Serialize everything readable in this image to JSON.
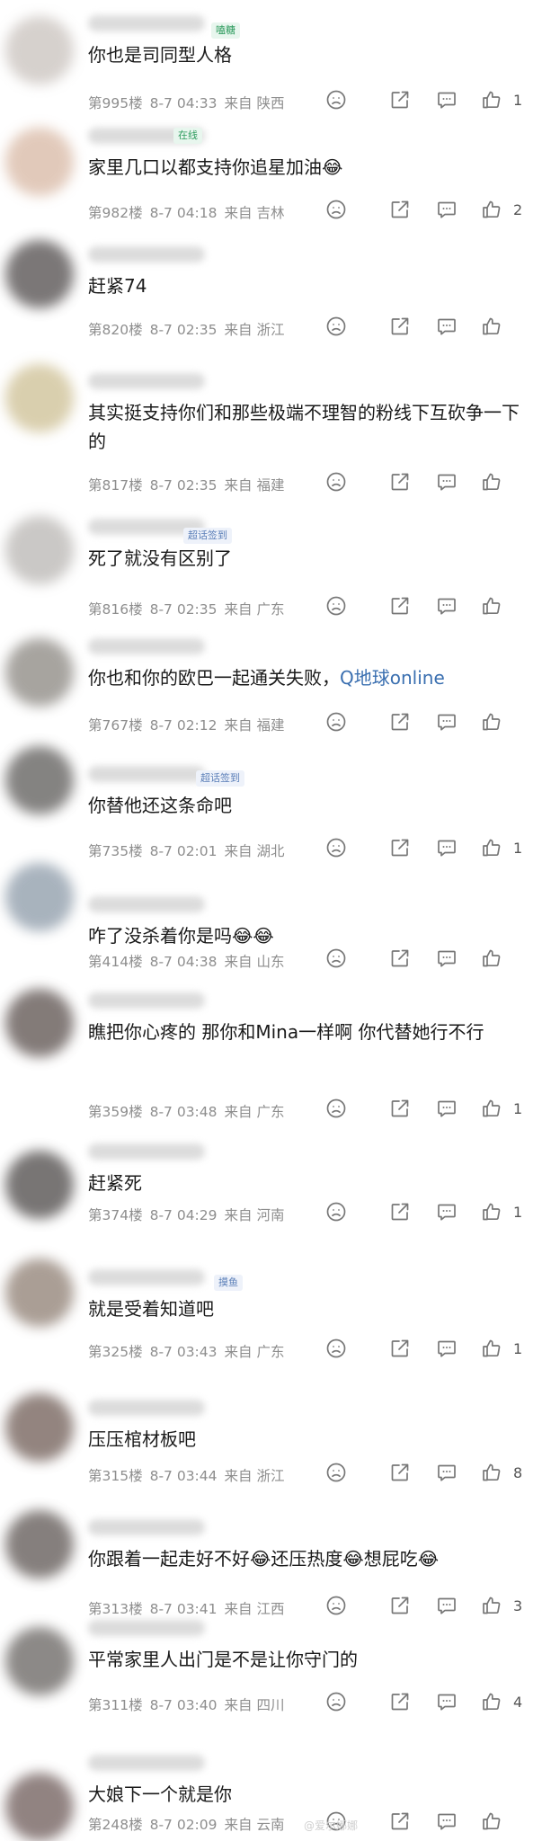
{
  "comments": [
    {
      "badge": "嗑糖",
      "badge_color": "#2e9b5e",
      "text": "你也是司同型人格",
      "floor": "第995楼",
      "time": "8-7 04:33",
      "source": "来自 陕西",
      "likes": "1"
    },
    {
      "badge": "在线",
      "badge_color": "#2e9b5e",
      "text": "家里几口以都支持你追星加油😂",
      "floor": "第982楼",
      "time": "8-7 04:18",
      "source": "来自 吉林",
      "likes": "2"
    },
    {
      "badge": "",
      "text": "赶紧74",
      "floor": "第820楼",
      "time": "8-7 02:35",
      "source": "来自 浙江",
      "likes": ""
    },
    {
      "badge": "",
      "text": "其实挺支持你们和那些极端不理智的粉线下互砍争一下的",
      "floor": "第817楼",
      "time": "8-7 02:35",
      "source": "来自 福建",
      "likes": ""
    },
    {
      "badge": "超话签到",
      "badge_color": "#5b7fb8",
      "text": "死了就没有区别了",
      "floor": "第816楼",
      "time": "8-7 02:35",
      "source": "来自 广东",
      "likes": ""
    },
    {
      "badge": "",
      "text": "你也和你的欧巴一起通关失败，",
      "tag": "Q地球online",
      "floor": "第767楼",
      "time": "8-7 02:12",
      "source": "来自 福建",
      "likes": ""
    },
    {
      "badge": "超话签到",
      "badge_color": "#5b7fb8",
      "text": "你替他还这条命吧",
      "floor": "第735楼",
      "time": "8-7 02:01",
      "source": "来自 湖北",
      "likes": "1"
    },
    {
      "badge": "",
      "text": "咋了没杀着你是吗😂😂",
      "floor": "第414楼",
      "time": "8-7 04:38",
      "source": "来自 山东",
      "likes": ""
    },
    {
      "badge": "",
      "text": "瞧把你心疼的 那你和Mina一样啊 你代替她行不行",
      "floor": "第359楼",
      "time": "8-7 03:48",
      "source": "来自 广东",
      "likes": "1"
    },
    {
      "badge": "",
      "text": "赶紧死",
      "floor": "第374楼",
      "time": "8-7 04:29",
      "source": "来自 河南",
      "likes": "1"
    },
    {
      "badge": "摸鱼",
      "badge_color": "#5b7fb8",
      "text": "就是受着知道吧",
      "floor": "第325楼",
      "time": "8-7 03:43",
      "source": "来自 广东",
      "likes": "1"
    },
    {
      "badge": "",
      "text": "压压棺材板吧",
      "floor": "第315楼",
      "time": "8-7 03:44",
      "source": "来自 浙江",
      "likes": "8"
    },
    {
      "badge": "",
      "text": "你跟着一起走好不好😂还压热度😂想屁吃😂",
      "floor": "第313楼",
      "time": "8-7 03:41",
      "source": "来自 江西",
      "likes": "3"
    },
    {
      "badge": "",
      "text": "平常家里人出门是不是让你守门的",
      "floor": "第311楼",
      "time": "8-7 03:40",
      "source": "来自 四川",
      "likes": "4"
    },
    {
      "badge": "",
      "text": "大娘下一个就是你",
      "floor": "第248楼",
      "time": "8-7 02:09",
      "source": "来自 云南",
      "likes": ""
    }
  ],
  "icons": {
    "dislike": "sad-face-icon",
    "share": "share-icon",
    "reply": "comment-icon",
    "like": "thumbs-up-icon"
  },
  "colors": {
    "meta": "#8e8e8e",
    "text": "#1a1a1a",
    "topic_link": "#3a6fb0",
    "badge_green": "#2e9b5e",
    "badge_blue": "#5b7fb8"
  },
  "watermark": "@爱尔娜娜"
}
